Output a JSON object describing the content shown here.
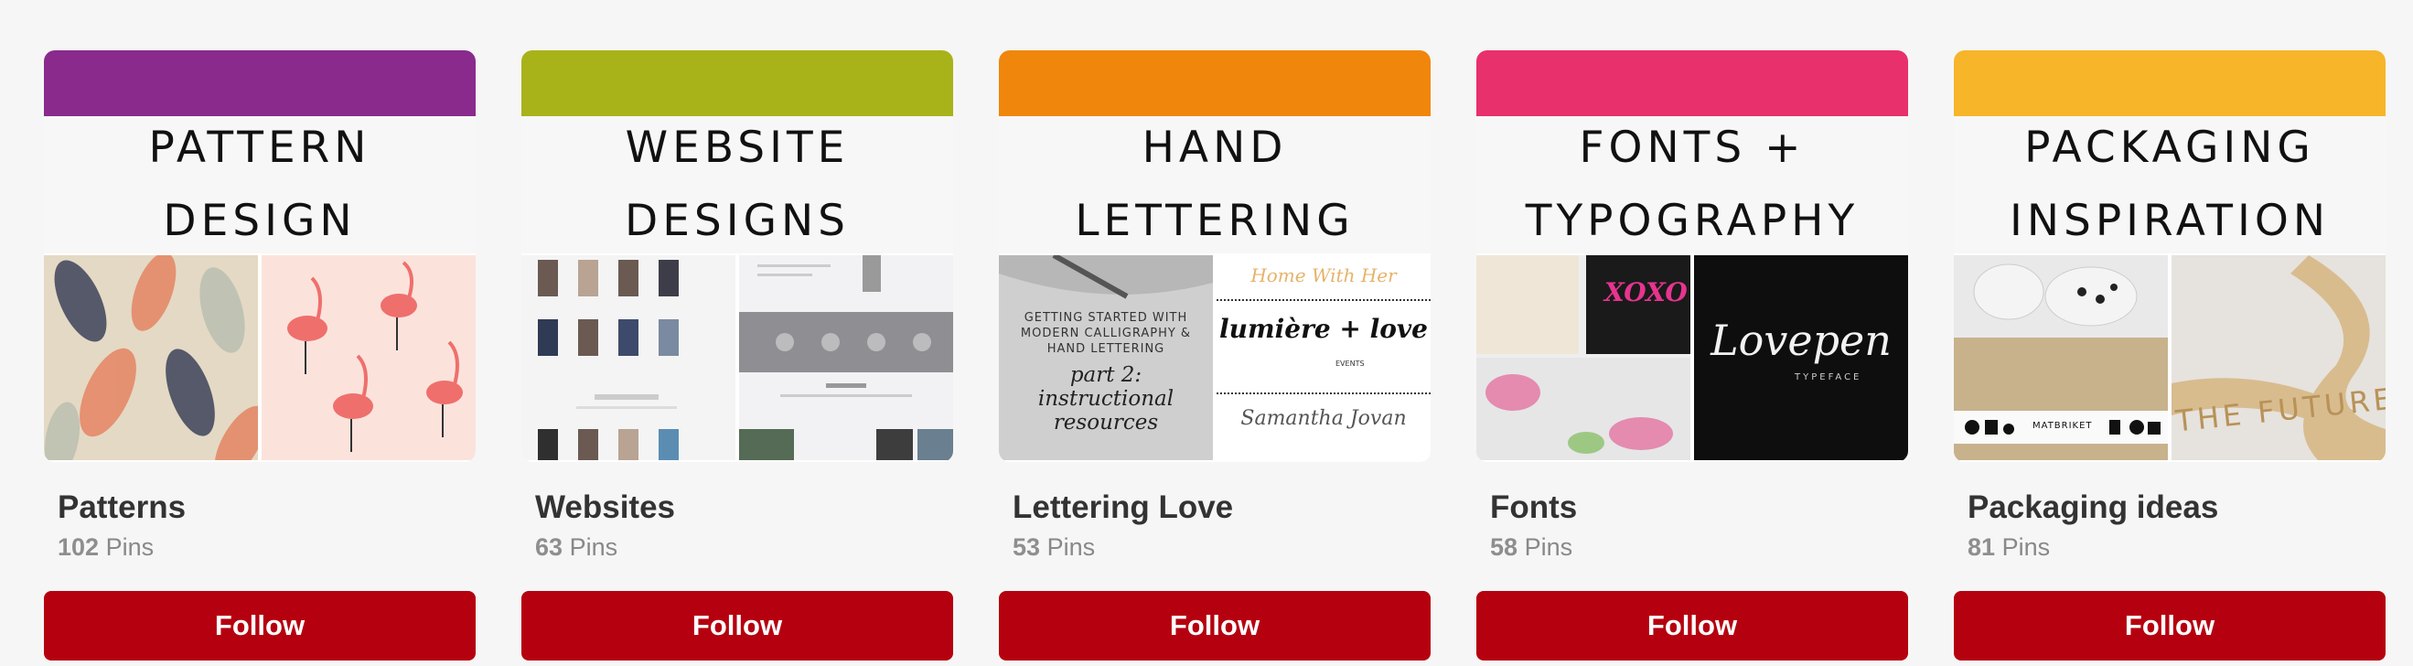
{
  "boards": [
    {
      "band_color": "#8a2a8c",
      "cover_lines": [
        "PATTERN",
        "DESIGN"
      ],
      "name": "Patterns",
      "pin_count": "102",
      "pins_label": "Pins",
      "follow_label": "Follow"
    },
    {
      "band_color": "#a8b31a",
      "cover_lines": [
        "WEBSITE",
        "DESIGNS"
      ],
      "name": "Websites",
      "pin_count": "63",
      "pins_label": "Pins",
      "follow_label": "Follow"
    },
    {
      "band_color": "#f0860c",
      "cover_lines": [
        "HAND",
        "LETTERING"
      ],
      "name": "Lettering Love",
      "pin_count": "53",
      "pins_label": "Pins",
      "follow_label": "Follow",
      "thumb_text": {
        "left_caption": "GETTING STARTED WITH MODERN CALLIGRAPHY & HAND LETTERING",
        "left_script": "part 2: instructional resources",
        "right_top": "Home With Her",
        "right_mid": "lumière + love",
        "right_sub": "EVENTS",
        "right_bottom": "Samantha Jovan"
      }
    },
    {
      "band_color": "#e8306c",
      "cover_lines": [
        "FONTS +",
        "TYPOGRAPHY"
      ],
      "name": "Fonts",
      "pin_count": "58",
      "pins_label": "Pins",
      "follow_label": "Follow",
      "thumb_text": {
        "left_top": "XOXO",
        "right_script": "Lovepen",
        "right_sub": "TYPEFACE"
      }
    },
    {
      "band_color": "#f7b52a",
      "cover_lines": [
        "PACKAGING",
        "INSPIRATION"
      ],
      "name": "Packaging ideas",
      "pin_count": "81",
      "pins_label": "Pins",
      "follow_label": "Follow",
      "thumb_text": {
        "left_tape": "MATBRIKET",
        "right_ribbon": "THE FUTURE"
      }
    }
  ]
}
